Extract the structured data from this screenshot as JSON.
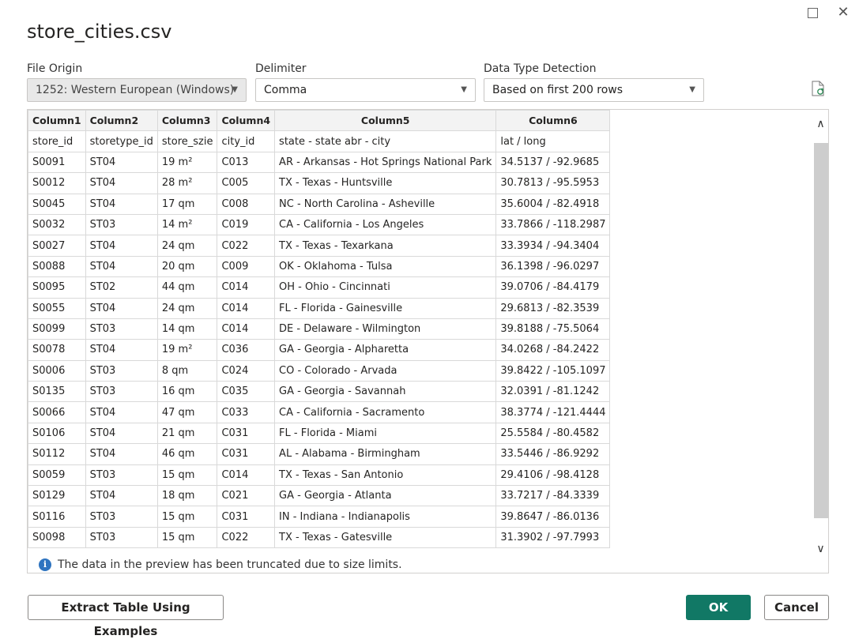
{
  "window": {
    "maximize_label": "",
    "close_label": "✕"
  },
  "title": "store_cities.csv",
  "file_origin": {
    "label": "File Origin",
    "value": "1252: Western European (Windows)"
  },
  "delimiter": {
    "label": "Delimiter",
    "value": "Comma"
  },
  "detection": {
    "label": "Data Type Detection",
    "value": "Based on first 200 rows"
  },
  "table": {
    "headers": [
      "Column1",
      "Column2",
      "Column3",
      "Column4",
      "Column5",
      "Column6"
    ],
    "rows": [
      [
        "store_id",
        "storetype_id",
        "store_szie",
        "city_id",
        "state - state abr - city",
        "lat / long"
      ],
      [
        "S0091",
        "ST04",
        "19 m²",
        "C013",
        "AR - Arkansas - Hot Springs National Park",
        "34.5137 / -92.9685"
      ],
      [
        "S0012",
        "ST04",
        "28 m²",
        "C005",
        "TX - Texas - Huntsville",
        "30.7813 / -95.5953"
      ],
      [
        "S0045",
        "ST04",
        "17 qm",
        "C008",
        "NC - North Carolina - Asheville",
        "35.6004 / -82.4918"
      ],
      [
        "S0032",
        "ST03",
        "14 m²",
        "C019",
        "CA - California - Los Angeles",
        "33.7866 / -118.2987"
      ],
      [
        "S0027",
        "ST04",
        "24 qm",
        "C022",
        "TX - Texas - Texarkana",
        "33.3934 / -94.3404"
      ],
      [
        "S0088",
        "ST04",
        "20 qm",
        "C009",
        "OK - Oklahoma - Tulsa",
        "36.1398 / -96.0297"
      ],
      [
        "S0095",
        "ST02",
        "44 qm",
        "C014",
        "OH - Ohio - Cincinnati",
        "39.0706 / -84.4179"
      ],
      [
        "S0055",
        "ST04",
        "24 qm",
        "C014",
        "FL - Florida - Gainesville",
        "29.6813 / -82.3539"
      ],
      [
        "S0099",
        "ST03",
        "14 qm",
        "C014",
        "DE - Delaware - Wilmington",
        "39.8188 / -75.5064"
      ],
      [
        "S0078",
        "ST04",
        "19 m²",
        "C036",
        "GA - Georgia - Alpharetta",
        "34.0268 / -84.2422"
      ],
      [
        "S0006",
        "ST03",
        "8 qm",
        "C024",
        "CO - Colorado - Arvada",
        "39.8422 / -105.1097"
      ],
      [
        "S0135",
        "ST03",
        "16 qm",
        "C035",
        "GA - Georgia - Savannah",
        "32.0391 / -81.1242"
      ],
      [
        "S0066",
        "ST04",
        "47 qm",
        "C033",
        "CA - California - Sacramento",
        "38.3774 / -121.4444"
      ],
      [
        "S0106",
        "ST04",
        "21 qm",
        "C031",
        "FL - Florida - Miami",
        "25.5584 / -80.4582"
      ],
      [
        "S0112",
        "ST04",
        "46 qm",
        "C031",
        "AL - Alabama - Birmingham",
        "33.5446 / -86.9292"
      ],
      [
        "S0059",
        "ST03",
        "15 qm",
        "C014",
        "TX - Texas - San Antonio",
        "29.4106 / -98.4128"
      ],
      [
        "S0129",
        "ST04",
        "18 qm",
        "C021",
        "GA - Georgia - Atlanta",
        "33.7217 / -84.3339"
      ],
      [
        "S0116",
        "ST03",
        "15 qm",
        "C031",
        "IN - Indiana - Indianapolis",
        "39.8647 / -86.0136"
      ],
      [
        "S0098",
        "ST03",
        "15 qm",
        "C022",
        "TX - Texas - Gatesville",
        "31.3902 / -97.7993"
      ]
    ]
  },
  "info": {
    "icon": "info-icon",
    "text": "The data in the preview has been truncated due to size limits."
  },
  "buttons": {
    "extract": "Extract Table Using Examples",
    "ok": "OK",
    "cancel": "Cancel"
  },
  "colors": {
    "primary": "#117865",
    "info": "#2f74c0"
  }
}
